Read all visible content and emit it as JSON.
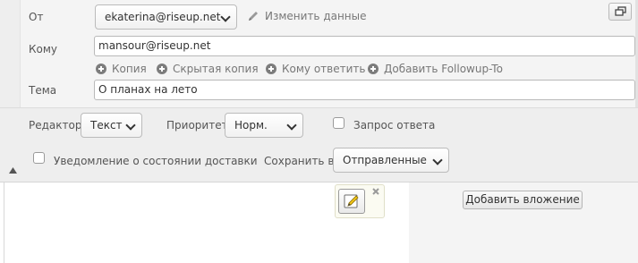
{
  "headers": {
    "from_label": "От",
    "from_value": "ekaterina@riseup.net",
    "edit_identity_label": "Изменить данные",
    "to_label": "Кому",
    "to_value": "mansour@riseup.net",
    "add_links": [
      "Копия",
      "Скрытая копия",
      "Кому ответить",
      "Добавить Followup-To"
    ],
    "subject_label": "Тема",
    "subject_value": "О планах на лето"
  },
  "options": {
    "editor_label": "Редактор",
    "editor_value": "Текст",
    "priority_label": "Приоритет",
    "priority_value": "Норм.",
    "receipt_label": "Запрос ответа",
    "dsn_label": "Уведомление о состоянии доставки",
    "save_label": "Сохранить в",
    "save_value": "Отправленные"
  },
  "attachments": {
    "add_button_label": "Добавить вложение"
  }
}
